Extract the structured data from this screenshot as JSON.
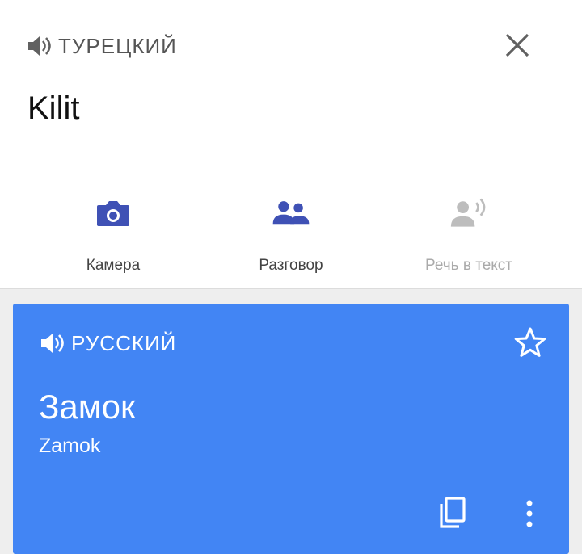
{
  "source": {
    "language": "ТУРЕЦКИЙ",
    "text": "Kilit"
  },
  "tools": [
    {
      "label": "Камера",
      "icon": "camera-icon",
      "enabled": true
    },
    {
      "label": "Разговор",
      "icon": "conversation-icon",
      "enabled": true
    },
    {
      "label": "Речь в текст",
      "icon": "speech-to-text-icon",
      "enabled": false
    }
  ],
  "result": {
    "language": "РУССКИЙ",
    "translation": "Замок",
    "transliteration": "Zamok"
  },
  "colors": {
    "accent": "#3f51b5",
    "card": "#4285f4",
    "disabled": "#bdbdbd",
    "icon_gray": "#616161"
  }
}
